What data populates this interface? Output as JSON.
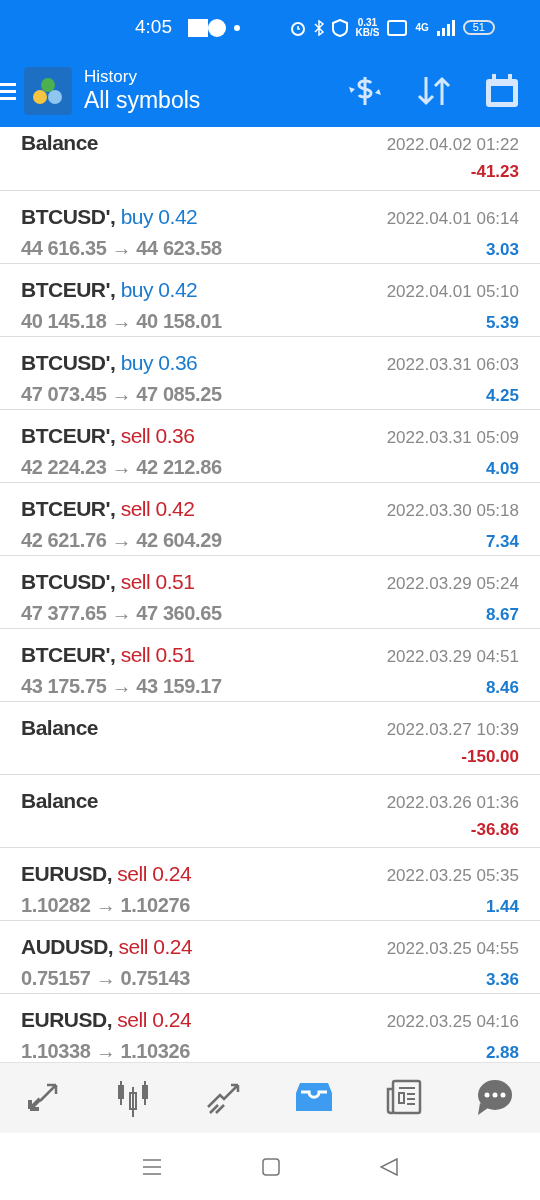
{
  "status_bar": {
    "time": "4:05",
    "speed": "0.31",
    "speed_unit": "KB/S",
    "network": "4G",
    "battery": "51"
  },
  "header": {
    "subtitle": "History",
    "title": "All symbols"
  },
  "rows": [
    {
      "kind": "balance",
      "title": "Balance",
      "time": "2022.04.02 01:22",
      "profit": "-41.23",
      "loss": true
    },
    {
      "kind": "trade",
      "symbol": "BTCUSD',",
      "side": "buy",
      "volume": "0.42",
      "color": "#1a7bd0",
      "prices": "44 616.35 → 44 623.58",
      "time": "2022.04.01 06:14",
      "profit": "3.03",
      "loss": false
    },
    {
      "kind": "trade",
      "symbol": "BTCEUR',",
      "side": "buy",
      "volume": "0.42",
      "color": "#1a7bd0",
      "prices": "40 145.18 → 40 158.01",
      "time": "2022.04.01 05:10",
      "profit": "5.39",
      "loss": false
    },
    {
      "kind": "trade",
      "symbol": "BTCUSD',",
      "side": "buy",
      "volume": "0.36",
      "color": "#1a7bd0",
      "prices": "47 073.45 → 47 085.25",
      "time": "2022.03.31 06:03",
      "profit": "4.25",
      "loss": false
    },
    {
      "kind": "trade",
      "symbol": "BTCEUR',",
      "side": "sell",
      "volume": "0.36",
      "color": "#c8232c",
      "prices": "42 224.23 → 42 212.86",
      "time": "2022.03.31 05:09",
      "profit": "4.09",
      "loss": false
    },
    {
      "kind": "trade",
      "symbol": "BTCEUR',",
      "side": "sell",
      "volume": "0.42",
      "color": "#c8232c",
      "prices": "42 621.76 → 42 604.29",
      "time": "2022.03.30 05:18",
      "profit": "7.34",
      "loss": false
    },
    {
      "kind": "trade",
      "symbol": "BTCUSD',",
      "side": "sell",
      "volume": "0.51",
      "color": "#c8232c",
      "prices": "47 377.65 → 47 360.65",
      "time": "2022.03.29 05:24",
      "profit": "8.67",
      "loss": false
    },
    {
      "kind": "trade",
      "symbol": "BTCEUR',",
      "side": "sell",
      "volume": "0.51",
      "color": "#c8232c",
      "prices": "43 175.75 → 43 159.17",
      "time": "2022.03.29 04:51",
      "profit": "8.46",
      "loss": false
    },
    {
      "kind": "balance",
      "title": "Balance",
      "time": "2022.03.27 10:39",
      "profit": "-150.00",
      "loss": true
    },
    {
      "kind": "balance",
      "title": "Balance",
      "time": "2022.03.26 01:36",
      "profit": "-36.86",
      "loss": true
    },
    {
      "kind": "trade",
      "symbol": "EURUSD,",
      "side": "sell",
      "volume": "0.24",
      "color": "#c8232c",
      "prices": "1.10282 → 1.10276",
      "time": "2022.03.25 05:35",
      "profit": "1.44",
      "loss": false
    },
    {
      "kind": "trade",
      "symbol": "AUDUSD,",
      "side": "sell",
      "volume": "0.24",
      "color": "#c8232c",
      "prices": "0.75157 → 0.75143",
      "time": "2022.03.25 04:55",
      "profit": "3.36",
      "loss": false
    },
    {
      "kind": "trade",
      "symbol": "EURUSD,",
      "side": "sell",
      "volume": "0.24",
      "color": "#c8232c",
      "prices": "1.10338 → 1.10326",
      "time": "2022.03.25 04:16",
      "profit": "2.88",
      "loss": false
    }
  ],
  "bottom_nav": [
    {
      "kind": "quotes",
      "selected": false
    },
    {
      "kind": "chart",
      "selected": false
    },
    {
      "kind": "trade",
      "selected": false
    },
    {
      "kind": "history",
      "selected": true
    },
    {
      "kind": "news",
      "selected": false
    },
    {
      "kind": "chat",
      "selected": false
    }
  ]
}
